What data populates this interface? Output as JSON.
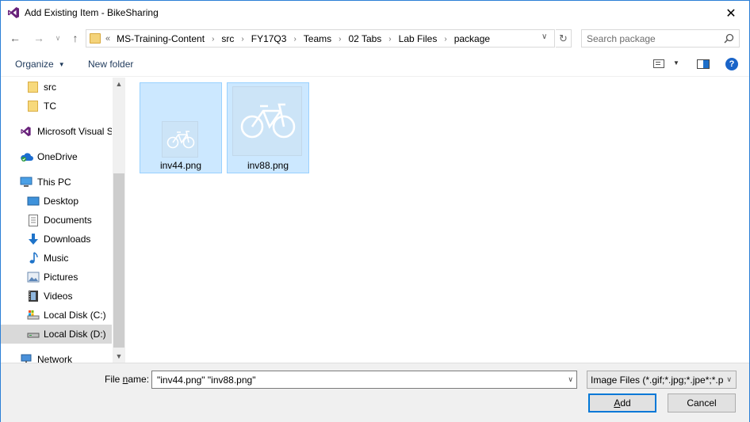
{
  "window": {
    "title": "Add Existing Item - BikeSharing",
    "close_glyph": "✕"
  },
  "navigation": {
    "back_glyph": "←",
    "forward_glyph": "→",
    "recent_glyph": "∨",
    "up_glyph": "↑",
    "overflow_glyph": "«",
    "breadcrumbs": [
      "MS-Training-Content",
      "src",
      "FY17Q3",
      "Teams",
      "02 Tabs",
      "Lab Files",
      "package"
    ],
    "separator": "›",
    "dropdown_glyph": "∨",
    "refresh_glyph": "↻"
  },
  "search": {
    "placeholder": "Search package"
  },
  "toolbar": {
    "organize_label": "Organize",
    "organize_caret": "▼",
    "new_folder_label": "New folder",
    "view_dropdown_glyph": "▼",
    "help_glyph": "?"
  },
  "sidebar": {
    "items": [
      {
        "label": "src",
        "icon": "folder-icon"
      },
      {
        "label": "TC",
        "icon": "folder-icon"
      },
      {
        "label": "Microsoft Visual S",
        "icon": "visual-studio-icon"
      },
      {
        "label": "OneDrive",
        "icon": "onedrive-icon"
      },
      {
        "label": "This PC",
        "icon": "computer-icon"
      },
      {
        "label": "Desktop",
        "icon": "desktop-icon"
      },
      {
        "label": "Documents",
        "icon": "documents-icon"
      },
      {
        "label": "Downloads",
        "icon": "downloads-icon"
      },
      {
        "label": "Music",
        "icon": "music-icon"
      },
      {
        "label": "Pictures",
        "icon": "pictures-icon"
      },
      {
        "label": "Videos",
        "icon": "videos-icon"
      },
      {
        "label": "Local Disk (C:)",
        "icon": "drive-icon"
      },
      {
        "label": "Local Disk (D:)",
        "icon": "drive-icon"
      },
      {
        "label": "Network",
        "icon": "network-icon"
      }
    ],
    "scroll_up_glyph": "▲",
    "scroll_down_glyph": "▼"
  },
  "files": [
    {
      "name": "inv44.png",
      "selected": true,
      "icon": "bicycle-icon"
    },
    {
      "name": "inv88.png",
      "selected": true,
      "icon": "bicycle-icon"
    }
  ],
  "footer": {
    "file_name_label_prefix": "File ",
    "file_name_label_accel": "n",
    "file_name_label_suffix": "ame:",
    "file_name_value": "\"inv44.png\" \"inv88.png\"",
    "file_type_value": "Image Files (*.gif;*.jpg;*.jpe*;*.png;*.bmp;*.dib;*.tif;*.wmf;*.ras;*.eps;*.pcx;*.pcd;*.tga)",
    "dropdown_glyph": "∨",
    "add_accel": "A",
    "add_rest": "dd",
    "cancel_label": "Cancel"
  },
  "colors": {
    "selection": "#cce8ff",
    "selection_border": "#99d1ff",
    "accent": "#0078d7",
    "folder": "#f4d37a"
  }
}
